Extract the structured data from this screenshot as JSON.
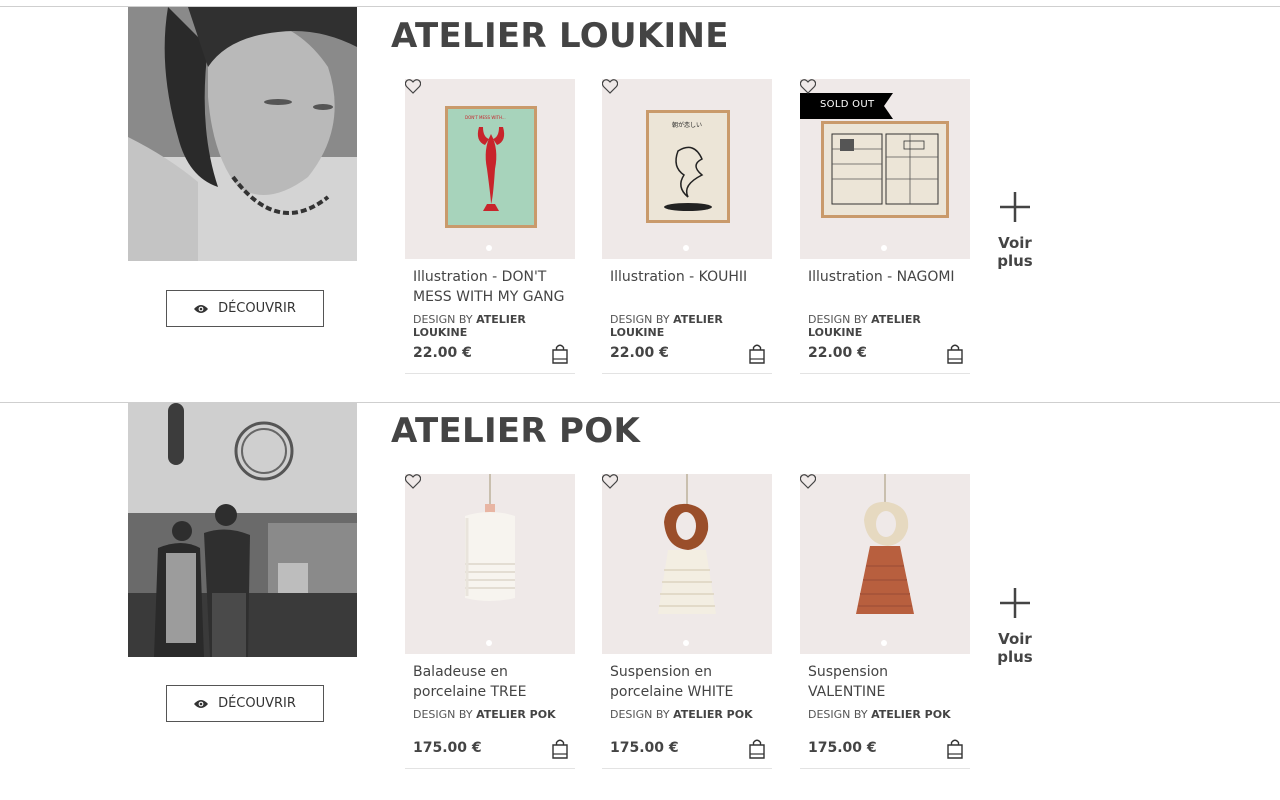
{
  "sections": [
    {
      "title": "ATELIER LOUKINE",
      "discover_label": "DÉCOUVRIR",
      "products": [
        {
          "name": "Illustration - DON'T MESS WITH MY GANG",
          "design_prefix": "DESIGN BY",
          "designer": "ATELIER LOUKINE",
          "price": "22.00 €",
          "badge": "",
          "poster_caption": "DON'T MESS WITH..."
        },
        {
          "name": "Illustration - KOUHII",
          "design_prefix": "DESIGN BY",
          "designer": "ATELIER LOUKINE",
          "price": "22.00 €",
          "badge": "",
          "poster_caption": "朝が恋しい"
        },
        {
          "name": "Illustration - NAGOMI",
          "design_prefix": "DESIGN BY",
          "designer": "ATELIER LOUKINE",
          "price": "22.00 €",
          "badge": "SOLD OUT",
          "poster_caption": ""
        }
      ],
      "more_label": "Voir plus"
    },
    {
      "title": "ATELIER POK",
      "discover_label": "DÉCOUVRIR",
      "products": [
        {
          "name": "Baladeuse en porcelaine TREE",
          "design_prefix": "DESIGN BY",
          "designer": "ATELIER POK",
          "price": "175.00 €",
          "badge": ""
        },
        {
          "name": "Suspension en porcelaine WHITE",
          "design_prefix": "DESIGN BY",
          "designer": "ATELIER POK",
          "price": "175.00 €",
          "badge": ""
        },
        {
          "name": "Suspension VALENTINE",
          "design_prefix": "DESIGN BY",
          "designer": "ATELIER POK",
          "price": "175.00 €",
          "badge": ""
        }
      ],
      "more_label": "Voir plus"
    }
  ],
  "colors": {
    "card_bg": "#efe9e8",
    "badge_bg": "#000000",
    "text": "#444444"
  },
  "icons": {
    "favorite": "heart-icon",
    "cart": "shopping-bag-icon",
    "discover": "eye-icon",
    "more": "plus-icon"
  }
}
